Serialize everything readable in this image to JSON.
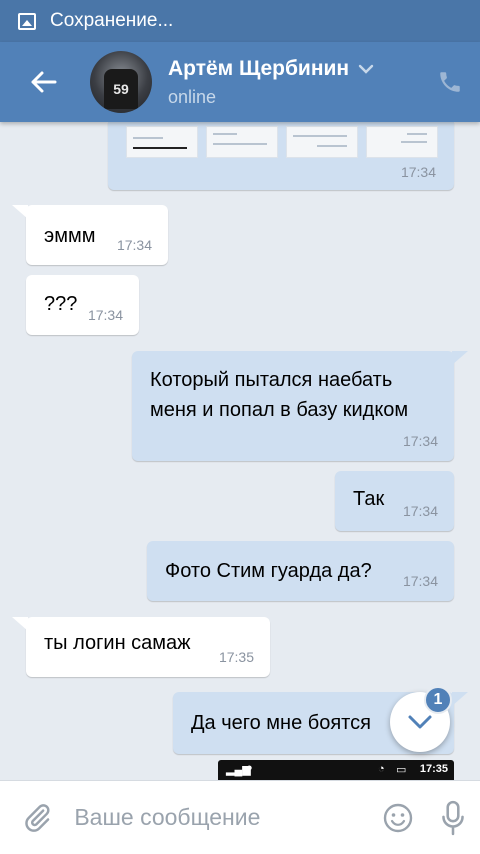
{
  "statusbar": {
    "text": "Сохранение..."
  },
  "header": {
    "title": "Артём Щербинин",
    "subtitle": "online"
  },
  "preview": {
    "time": "17:34"
  },
  "messages": [
    {
      "dir": "in",
      "text": "эммм",
      "time": "17:34"
    },
    {
      "dir": "in",
      "text": "???",
      "time": "17:34"
    },
    {
      "dir": "out",
      "text": "Который пытался наебать\nменя и попал в базу кидком",
      "time": "17:34"
    },
    {
      "dir": "out",
      "text": "Так",
      "time": "17:34"
    },
    {
      "dir": "out",
      "text": "Фото Стим гуарда да?",
      "time": "17:34"
    },
    {
      "dir": "in",
      "text": "ты логин самаж",
      "time": "17:35"
    },
    {
      "dir": "out",
      "text": "Да чего мне боятся",
      "time": ""
    }
  ],
  "phone_preview": {
    "clock": "17:35"
  },
  "scroll_badge": {
    "count": "1"
  },
  "composer": {
    "placeholder": "Ваше сообщение"
  },
  "colors": {
    "header": "#5181b8",
    "statusbar": "#4a76a8",
    "out_bubble": "#cfdff1",
    "in_bubble": "#ffffff",
    "background": "#e6ebf1"
  }
}
